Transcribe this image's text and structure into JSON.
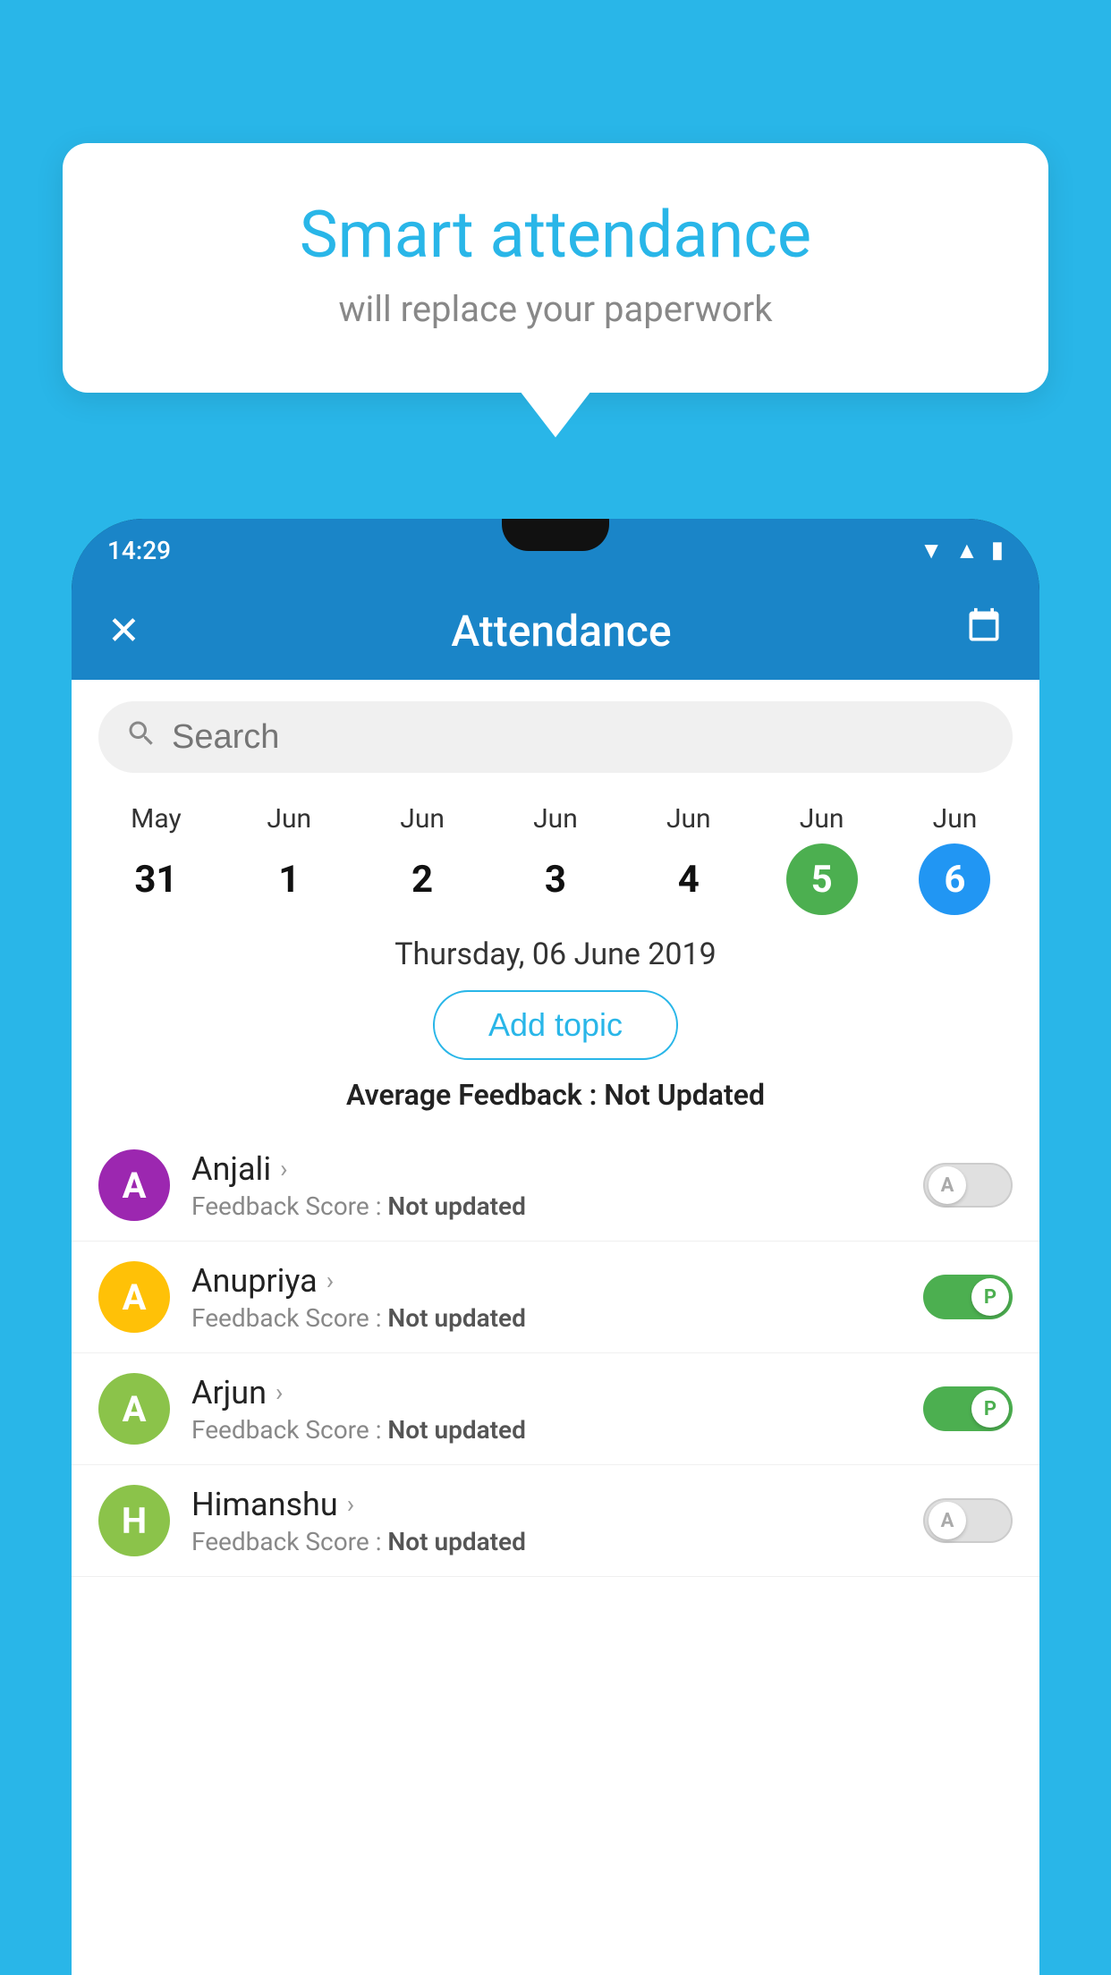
{
  "background_color": "#29B6E8",
  "speech_bubble": {
    "title": "Smart attendance",
    "subtitle": "will replace your paperwork"
  },
  "phone": {
    "status_bar": {
      "time": "14:29",
      "icons": [
        "wifi",
        "signal",
        "battery"
      ]
    },
    "app_bar": {
      "title": "Attendance",
      "close_icon": "✕",
      "calendar_icon": "📅"
    },
    "search": {
      "placeholder": "Search"
    },
    "calendar": {
      "days": [
        {
          "month": "May",
          "date": "31",
          "state": "normal"
        },
        {
          "month": "Jun",
          "date": "1",
          "state": "normal"
        },
        {
          "month": "Jun",
          "date": "2",
          "state": "normal"
        },
        {
          "month": "Jun",
          "date": "3",
          "state": "normal"
        },
        {
          "month": "Jun",
          "date": "4",
          "state": "normal"
        },
        {
          "month": "Jun",
          "date": "5",
          "state": "today"
        },
        {
          "month": "Jun",
          "date": "6",
          "state": "selected"
        }
      ]
    },
    "selected_date": "Thursday, 06 June 2019",
    "add_topic_label": "Add topic",
    "avg_feedback_label": "Average Feedback :",
    "avg_feedback_value": "Not Updated",
    "students": [
      {
        "name": "Anjali",
        "avatar_letter": "A",
        "avatar_color": "#9C27B0",
        "feedback": "Not updated",
        "attendance": "absent"
      },
      {
        "name": "Anupriya",
        "avatar_letter": "A",
        "avatar_color": "#FFC107",
        "feedback": "Not updated",
        "attendance": "present"
      },
      {
        "name": "Arjun",
        "avatar_letter": "A",
        "avatar_color": "#8BC34A",
        "feedback": "Not updated",
        "attendance": "present"
      },
      {
        "name": "Himanshu",
        "avatar_letter": "H",
        "avatar_color": "#8BC34A",
        "feedback": "Not updated",
        "attendance": "absent"
      }
    ]
  }
}
